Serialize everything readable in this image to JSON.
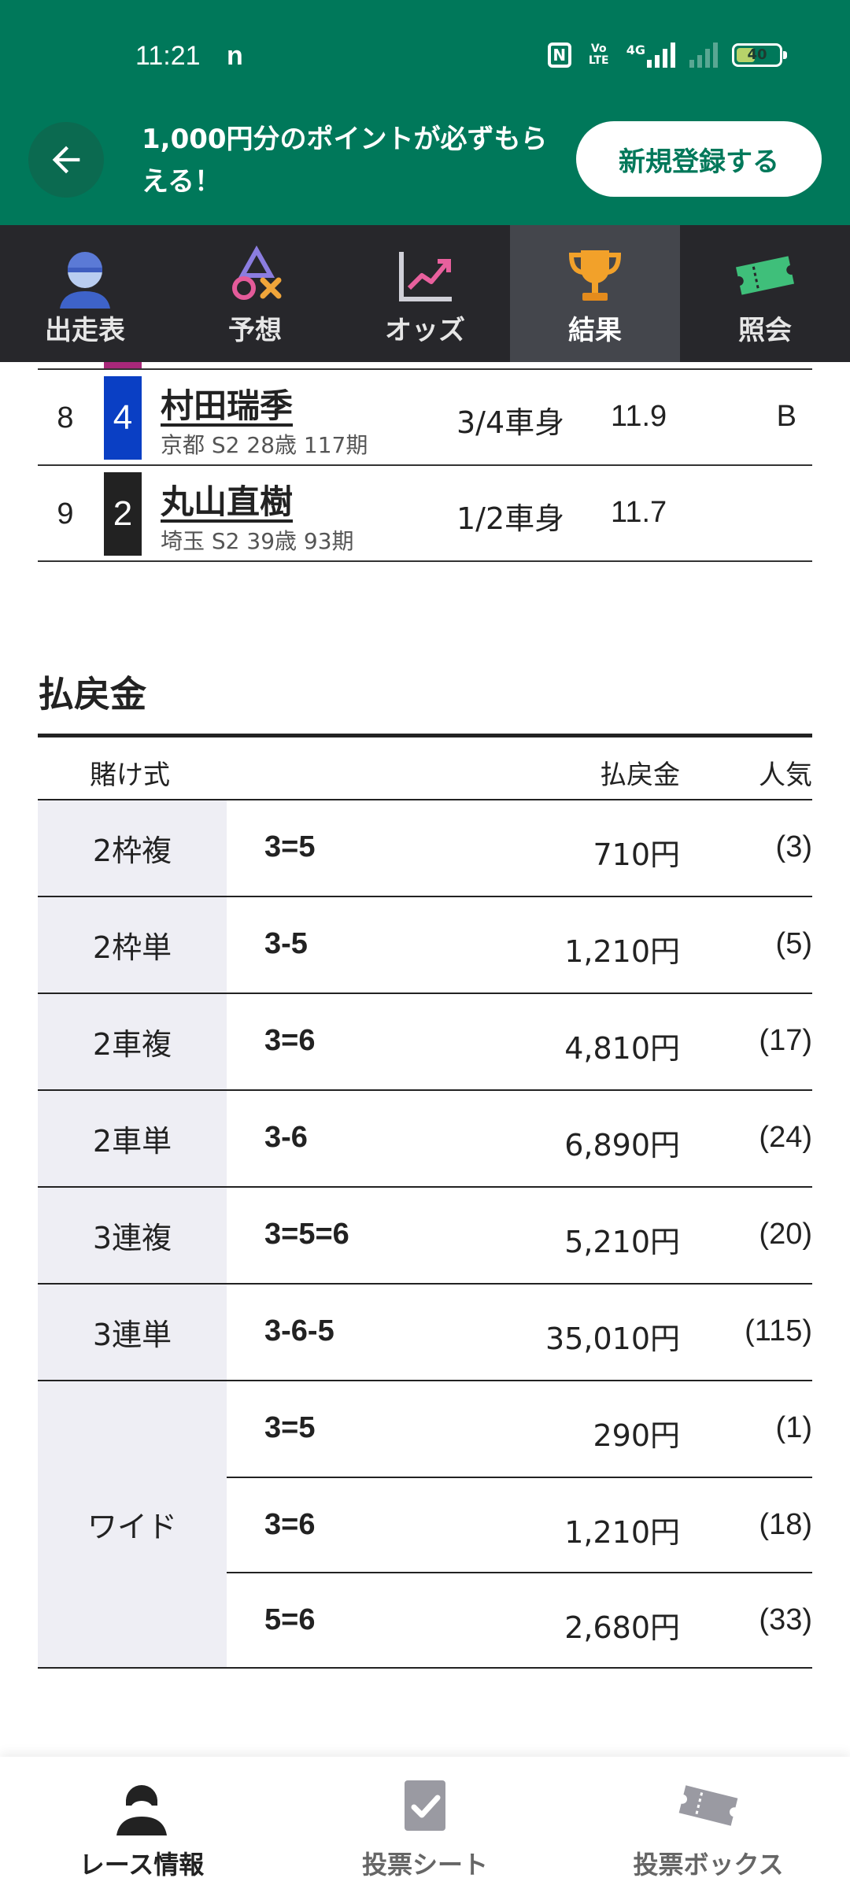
{
  "status_bar": {
    "time": "11:21",
    "app_icon": "n",
    "nfc": "N",
    "volte": "Vo LTE",
    "network": "4G",
    "battery": "40",
    "battery_level": 0.4
  },
  "promo": {
    "text": "1,000円分のポイントが必ずもらえる！",
    "register_label": "新規登録する"
  },
  "nav": {
    "tabs": [
      {
        "label": "出走表",
        "icon": "jockey-icon"
      },
      {
        "label": "予想",
        "icon": "prediction-symbols-icon"
      },
      {
        "label": "オッズ",
        "icon": "odds-chart-icon"
      },
      {
        "label": "結果",
        "icon": "trophy-icon",
        "active": true
      },
      {
        "label": "照会",
        "icon": "ticket-icon"
      }
    ]
  },
  "race_results": {
    "rows": [
      {
        "rank": "8",
        "number": "4",
        "number_color": "#0a3fc4",
        "name": "村田瑞季",
        "info": "京都 S2 28歳 117期",
        "margin": "3/4車身",
        "time": "11.9",
        "mark": "B"
      },
      {
        "rank": "9",
        "number": "2",
        "number_color": "#222222",
        "name": "丸山直樹",
        "info": "埼玉 S2 39歳 93期",
        "margin": "1/2車身",
        "time": "11.7",
        "mark": ""
      }
    ]
  },
  "payout": {
    "title": "払戻金",
    "headers": {
      "type": "賭け式",
      "amount": "払戻金",
      "popularity": "人気"
    },
    "groups": [
      {
        "type": "2枠複",
        "lines": [
          {
            "combo": "3=5",
            "amount": "710円",
            "popularity": "(3)"
          }
        ]
      },
      {
        "type": "2枠単",
        "lines": [
          {
            "combo": "3-5",
            "amount": "1,210円",
            "popularity": "(5)"
          }
        ]
      },
      {
        "type": "2車複",
        "lines": [
          {
            "combo": "3=6",
            "amount": "4,810円",
            "popularity": "(17)"
          }
        ]
      },
      {
        "type": "2車単",
        "lines": [
          {
            "combo": "3-6",
            "amount": "6,890円",
            "popularity": "(24)"
          }
        ]
      },
      {
        "type": "3連複",
        "lines": [
          {
            "combo": "3=5=6",
            "amount": "5,210円",
            "popularity": "(20)"
          }
        ]
      },
      {
        "type": "3連単",
        "lines": [
          {
            "combo": "3-6-5",
            "amount": "35,010円",
            "popularity": "(115)"
          }
        ]
      },
      {
        "type": "ワイド",
        "lines": [
          {
            "combo": "3=5",
            "amount": "290円",
            "popularity": "(1)"
          },
          {
            "combo": "3=6",
            "amount": "1,210円",
            "popularity": "(18)"
          },
          {
            "combo": "5=6",
            "amount": "2,680円",
            "popularity": "(33)"
          }
        ]
      }
    ]
  },
  "bottom_nav": {
    "tabs": [
      {
        "label": "レース情報",
        "icon": "racer-icon",
        "active": true
      },
      {
        "label": "投票シート",
        "icon": "vote-sheet-icon"
      },
      {
        "label": "投票ボックス",
        "icon": "ticket-box-icon"
      }
    ]
  }
}
